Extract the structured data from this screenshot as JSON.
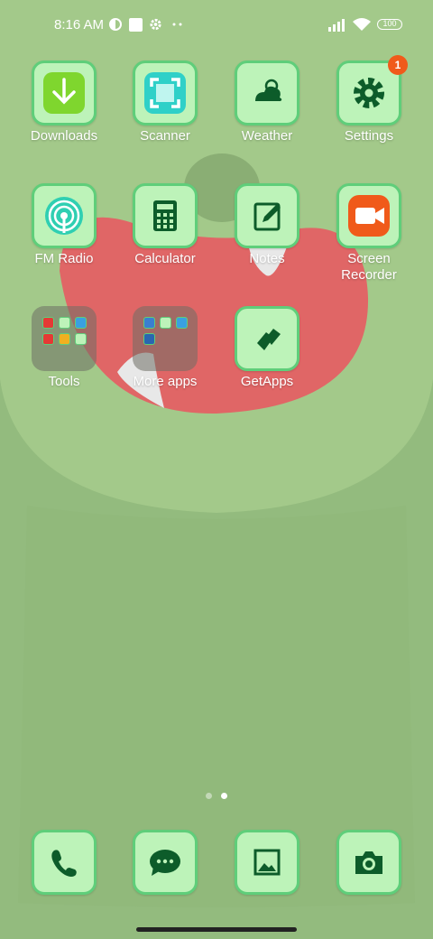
{
  "status_bar": {
    "time": "8:16 AM",
    "battery": "100",
    "icons": [
      "data-saver-icon",
      "square-notification-icon",
      "gear-icon",
      "more-dots-icon",
      "signal-icon",
      "wifi-icon",
      "battery-icon"
    ]
  },
  "apps": {
    "downloads": "Downloads",
    "scanner": "Scanner",
    "weather": "Weather",
    "settings": "Settings",
    "settings_badge": "1",
    "fm_radio": "FM Radio",
    "calculator": "Calculator",
    "notes": "Notes",
    "screen_recorder_line1": "Screen",
    "screen_recorder_line2": "Recorder",
    "tools": "Tools",
    "more_apps": "More apps",
    "getapps": "GetApps"
  },
  "page_indicator": {
    "pages": 2,
    "current": 2
  },
  "dock": [
    "phone-icon",
    "messages-icon",
    "gallery-icon",
    "camera-icon"
  ],
  "colors": {
    "wallpaper": "#a3c98a",
    "tile": "#bdf3b9",
    "tile_border": "#5fce7a",
    "icon": "#0d5c2a",
    "badge": "#f05a1a",
    "recorder": "#f05a1a"
  }
}
